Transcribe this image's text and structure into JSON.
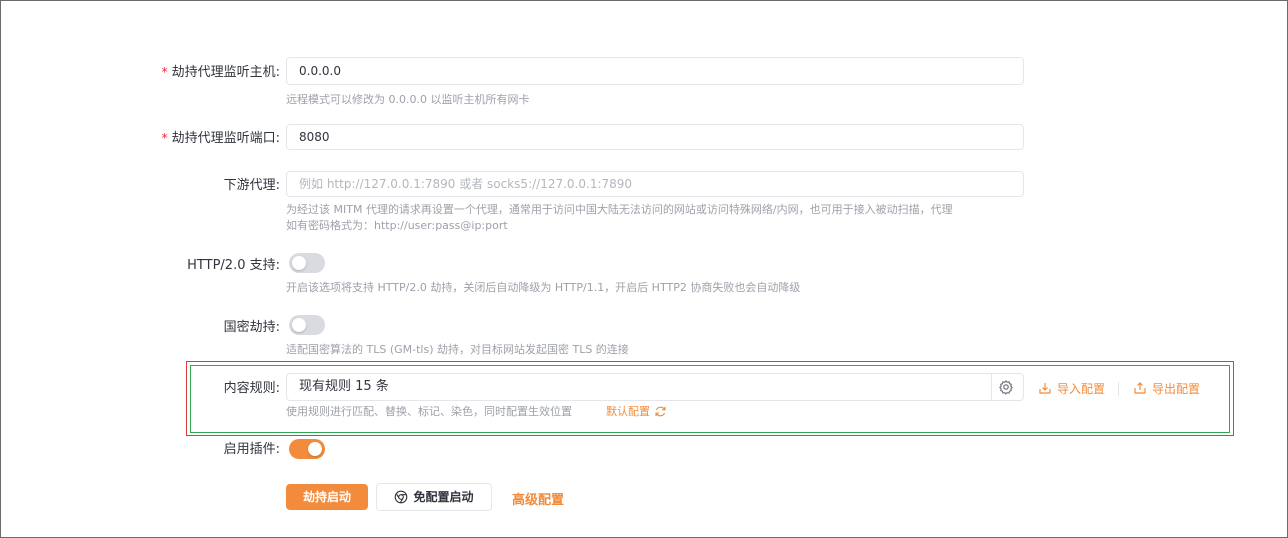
{
  "fields": {
    "host": {
      "label": "劫持代理监听主机:",
      "value": "0.0.0.0",
      "help": "远程模式可以修改为 0.0.0.0 以监听主机所有网卡"
    },
    "port": {
      "label": "劫持代理监听端口:",
      "value": "8080"
    },
    "downstream": {
      "label": "下游代理:",
      "placeholder": "例如 http://127.0.0.1:7890 或者 socks5://127.0.0.1:7890",
      "help_line1": "为经过该 MITM 代理的请求再设置一个代理，通常用于访问中国大陆无法访问的网站或访问特殊网络/内网，也可用于接入被动扫描，代理",
      "help_line2": "如有密码格式为：http://user:pass@ip:port"
    },
    "http2": {
      "label": "HTTP/2.0 支持:",
      "enabled": false,
      "help": "开启该选项将支持 HTTP/2.0 劫持，关闭后自动降级为 HTTP/1.1，开启后 HTTP2 协商失败也会自动降级"
    },
    "gm": {
      "label": "国密劫持:",
      "enabled": false,
      "help": "适配国密算法的 TLS (GM-tls) 劫持，对目标网站发起国密 TLS 的连接"
    },
    "rules": {
      "label": "内容规则:",
      "value": "现有规则 15 条",
      "import_label": "导入配置",
      "export_label": "导出配置",
      "help": "使用规则进行匹配、替换、标记、染色，同时配置生效位置",
      "default_label": "默认配置"
    },
    "plugins": {
      "label": "启用插件:",
      "enabled": true
    }
  },
  "actions": {
    "start_label": "劫持启动",
    "no_config_start_label": "免配置启动",
    "advanced_label": "高级配置"
  },
  "colors": {
    "accent": "#f28b3b",
    "required": "#f5222d",
    "highlight_red": "#e03b3b",
    "highlight_green": "#2fa84f"
  }
}
